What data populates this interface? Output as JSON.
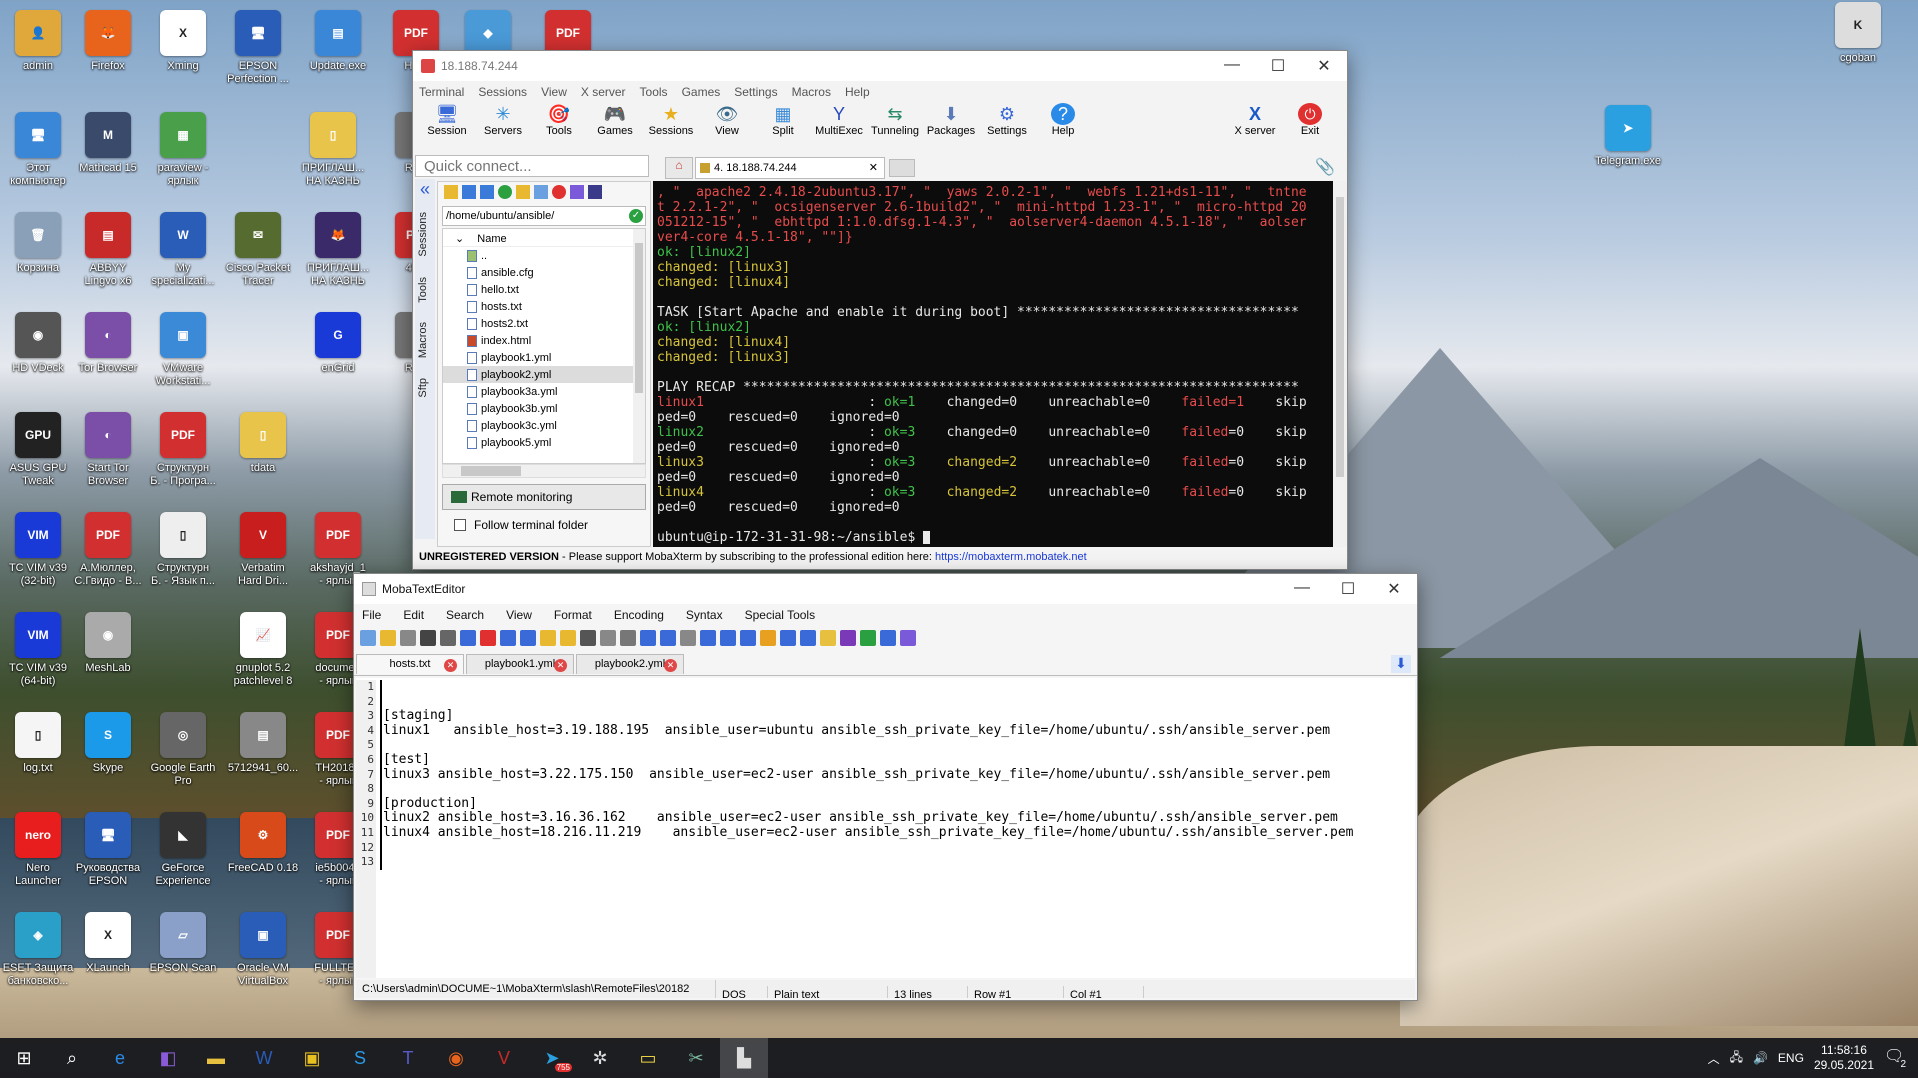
{
  "desktop_icons": [
    {
      "name": "admin",
      "label": "admin",
      "color": "#e0a83a",
      "glyph": "👤"
    },
    {
      "name": "firefox",
      "label": "Firefox",
      "color": "#e8641c",
      "glyph": "🦊"
    },
    {
      "name": "xming",
      "label": "Xming",
      "color": "#ffffff",
      "glyph": "X"
    },
    {
      "name": "epson-perfection",
      "label": "EPSON\nPerfection ...",
      "color": "#2a5db8",
      "glyph": "🖥"
    },
    {
      "name": "update-exe",
      "label": "Update.exe",
      "color": "#3a87d8",
      "glyph": "▤"
    },
    {
      "name": "pdf-hem",
      "label": "Hem",
      "color": "#d23030",
      "glyph": "PDF"
    },
    {
      "name": "app-colorful",
      "label": "",
      "color": "#4a9ad8",
      "glyph": "◆"
    },
    {
      "name": "pdf-top",
      "label": "",
      "color": "#d23030",
      "glyph": "PDF"
    },
    {
      "name": "this-computer",
      "label": "Этот\nкомпьютер",
      "color": "#3a87d8",
      "glyph": "🖥"
    },
    {
      "name": "mathcad",
      "label": "Mathcad 15",
      "color": "#3a4a6a",
      "glyph": "M"
    },
    {
      "name": "paraview",
      "label": "paraview -\nярлык",
      "color": "#4aa04a",
      "glyph": "▦"
    },
    {
      "name": "folder-priglash1",
      "label": "ПРИГЛАШ...\nНА КАЗНЬ",
      "color": "#e8c44a",
      "glyph": "▯"
    },
    {
      "name": "repo1",
      "label": "Repo",
      "color": "#777",
      "glyph": "▮"
    },
    {
      "name": "recycle-bin",
      "label": "Корзина",
      "color": "#8aa0b8",
      "glyph": "🗑"
    },
    {
      "name": "abbyy-lingvo",
      "label": "ABBYY\nLingvo x6",
      "color": "#c82a2a",
      "glyph": "▤"
    },
    {
      "name": "my-specialization",
      "label": "My\nspecializati...",
      "color": "#2a5db8",
      "glyph": "W"
    },
    {
      "name": "cisco-packet-tracer",
      "label": "Cisco Packet\nTracer",
      "color": "#556b2f",
      "glyph": "✉"
    },
    {
      "name": "priglash-firefox",
      "label": "ПРИГЛАШ...\nНА КАЗНЬ",
      "color": "#3a2a6a",
      "glyph": "🦊"
    },
    {
      "name": "pdf-4510",
      "label": "4510",
      "color": "#d23030",
      "glyph": "PDF"
    },
    {
      "name": "hd-vdeck",
      "label": "HD VDeck",
      "color": "#555",
      "glyph": "◉"
    },
    {
      "name": "tor-browser",
      "label": "Tor Browser",
      "color": "#7b4fa8",
      "glyph": "◐"
    },
    {
      "name": "vmware",
      "label": "VMware\nWorkstati...",
      "color": "#3a8ad8",
      "glyph": "▣"
    },
    {
      "name": "engrid",
      "label": "enGrid",
      "color": "#1a3ad8",
      "glyph": "G"
    },
    {
      "name": "repo2",
      "label": "Repo",
      "color": "#777",
      "glyph": "▮"
    },
    {
      "name": "asus-gpu-tweak",
      "label": "ASUS GPU\nTweak",
      "color": "#222",
      "glyph": "GPU"
    },
    {
      "name": "start-tor-browser",
      "label": "Start Tor\nBrowser",
      "color": "#7b4fa8",
      "glyph": "◐"
    },
    {
      "name": "pdf-struktur1",
      "label": "Структурн\nБ. - Програ...",
      "color": "#d23030",
      "glyph": "PDF"
    },
    {
      "name": "tdata",
      "label": "tdata",
      "color": "#e8c44a",
      "glyph": "▯"
    },
    {
      "name": "tc-vim-32",
      "label": "TC VIM v39\n(32-bit)",
      "color": "#1a3ad8",
      "glyph": "VIM"
    },
    {
      "name": "pdf-muller",
      "label": "А.Мюллер,\nС.Гвидо - В...",
      "color": "#d23030",
      "glyph": "PDF"
    },
    {
      "name": "file-struktur2",
      "label": "Структурн\nБ. - Язык п...",
      "color": "#eee",
      "glyph": "▯"
    },
    {
      "name": "verbatim",
      "label": "Verbatim\nHard Dri...",
      "color": "#c81e1e",
      "glyph": "V"
    },
    {
      "name": "pdf-akshayjd",
      "label": "akshayjd_1\n- ярлык",
      "color": "#d23030",
      "glyph": "PDF"
    },
    {
      "name": "tc-vim-64",
      "label": "TC VIM v39\n(64-bit)",
      "color": "#1a3ad8",
      "glyph": "VIM"
    },
    {
      "name": "meshlab",
      "label": "MeshLab",
      "color": "#aaa",
      "glyph": "◉"
    },
    {
      "name": "gnuplot",
      "label": "gnuplot 5.2\npatchlevel 8",
      "color": "#fff",
      "glyph": "📈"
    },
    {
      "name": "pdf-document",
      "label": "documen\n- ярлык",
      "color": "#d23030",
      "glyph": "PDF"
    },
    {
      "name": "log-txt",
      "label": "log.txt",
      "color": "#f5f5f5",
      "glyph": "▯"
    },
    {
      "name": "skype",
      "label": "Skype",
      "color": "#1a9ae8",
      "glyph": "S"
    },
    {
      "name": "google-earth-pro",
      "label": "Google Earth\nPro",
      "color": "#666",
      "glyph": "◎"
    },
    {
      "name": "file-5712941",
      "label": "5712941_60...",
      "color": "#888",
      "glyph": "▤"
    },
    {
      "name": "pdf-th2018",
      "label": "TH20180\n- ярлык",
      "color": "#d23030",
      "glyph": "PDF"
    },
    {
      "name": "nero-launcher",
      "label": "Nero\nLauncher",
      "color": "#e81e1e",
      "glyph": "nero"
    },
    {
      "name": "epson-guide",
      "label": "Руководства\nEPSON",
      "color": "#2a5db8",
      "glyph": "🖥"
    },
    {
      "name": "geforce-experience",
      "label": "GeForce\nExperience",
      "color": "#333",
      "glyph": "◣"
    },
    {
      "name": "freecad",
      "label": "FreeCAD 0.18",
      "color": "#d84a1a",
      "glyph": "⚙"
    },
    {
      "name": "pdf-ie5b",
      "label": "ie5b0048\n- ярлык",
      "color": "#d23030",
      "glyph": "PDF"
    },
    {
      "name": "eset",
      "label": "ESET Защита\nбанковско...",
      "color": "#2aa0c8",
      "glyph": "◈"
    },
    {
      "name": "xlaunch",
      "label": "XLaunch",
      "color": "#fff",
      "glyph": "X"
    },
    {
      "name": "epson-scan",
      "label": "EPSON Scan",
      "color": "#8aa0c8",
      "glyph": "▱"
    },
    {
      "name": "oracle-vm",
      "label": "Oracle VM\nVirtualBox",
      "color": "#2a5db8",
      "glyph": "▣"
    },
    {
      "name": "pdf-fulltext",
      "label": "FULLTEX\n- ярлык",
      "color": "#d23030",
      "glyph": "PDF"
    },
    {
      "name": "cgoban",
      "label": "cgoban",
      "color": "#ddd",
      "glyph": "K"
    },
    {
      "name": "telegram",
      "label": "Telegram.exe",
      "color": "#2aa0e0",
      "glyph": "➤"
    }
  ],
  "moba": {
    "title": "18.188.74.244",
    "menu": [
      "Terminal",
      "Sessions",
      "View",
      "X server",
      "Tools",
      "Games",
      "Settings",
      "Macros",
      "Help"
    ],
    "toolbar": [
      {
        "label": "Session",
        "glyph": "🖥"
      },
      {
        "label": "Servers",
        "glyph": "✳"
      },
      {
        "label": "Tools",
        "glyph": "🎯"
      },
      {
        "label": "Games",
        "glyph": "🎮"
      },
      {
        "label": "Sessions",
        "glyph": "★"
      },
      {
        "label": "View",
        "glyph": "👁"
      },
      {
        "label": "Split",
        "glyph": "▦"
      },
      {
        "label": "MultiExec",
        "glyph": "Y"
      },
      {
        "label": "Tunneling",
        "glyph": "⇆"
      },
      {
        "label": "Packages",
        "glyph": "⬇"
      },
      {
        "label": "Settings",
        "glyph": "⚙"
      },
      {
        "label": "Help",
        "glyph": "?"
      }
    ],
    "xserver_label": "X server",
    "exit_label": "Exit",
    "quick_connect_placeholder": "Quick connect...",
    "session_tab": "4. 18.188.74.244",
    "side_tabs": [
      "Sessions",
      "Tools",
      "Macros",
      "Sftp"
    ],
    "sftp_path": "/home/ubuntu/ansible/",
    "sftp_header": "Name",
    "sftp_files": [
      "..",
      "ansible.cfg",
      "hello.txt",
      "hosts.txt",
      "hosts2.txt",
      "index.html",
      "playbook1.yml",
      "playbook2.yml",
      "playbook3a.yml",
      "playbook3b.yml",
      "playbook3c.yml",
      "playbook5.yml"
    ],
    "remote_monitoring": "Remote monitoring",
    "follow_folder": "Follow terminal folder",
    "unregistered": "UNREGISTERED VERSION",
    "support_text": " -  Please support MobaXterm by subscribing to the professional edition here: ",
    "support_link": "https://mobaxterm.mobatek.net",
    "terminal_lines": [
      [
        {
          "c": "t-red",
          "t": ", \"  apache2 2.4.18-2ubuntu3.17\", \"  yaws 2.0.2-1\", \"  webfs 1.21+ds1-11\", \"  tntne"
        }
      ],
      [
        {
          "c": "t-red",
          "t": "t 2.2.1-2\", \"  ocsigenserver 2.6-1build2\", \"  mini-httpd 1.23-1\", \"  micro-httpd 20"
        }
      ],
      [
        {
          "c": "t-red",
          "t": "051212-15\", \"  ebhttpd 1:1.0.dfsg.1-4.3\", \"  aolserver4-daemon 4.5.1-18\", \"  aolser"
        }
      ],
      [
        {
          "c": "t-red",
          "t": "ver4-core 4.5.1-18\", \"\"]}"
        }
      ],
      [
        {
          "c": "t-grn",
          "t": "ok: [linux2]"
        }
      ],
      [
        {
          "c": "t-yel",
          "t": "changed: [linux3]"
        }
      ],
      [
        {
          "c": "t-yel",
          "t": "changed: [linux4]"
        }
      ],
      [
        {
          "c": "",
          "t": ""
        }
      ],
      [
        {
          "c": "t-wht",
          "t": "TASK [Start Apache and enable it during boot] ************************************"
        }
      ],
      [
        {
          "c": "t-grn",
          "t": "ok: [linux2]"
        }
      ],
      [
        {
          "c": "t-yel",
          "t": "changed: [linux4]"
        }
      ],
      [
        {
          "c": "t-yel",
          "t": "changed: [linux3]"
        }
      ],
      [
        {
          "c": "",
          "t": ""
        }
      ],
      [
        {
          "c": "t-wht",
          "t": "PLAY RECAP ***********************************************************************"
        }
      ],
      [
        {
          "c": "t-red",
          "t": "linux1"
        },
        {
          "c": "t-wht",
          "t": "                     : "
        },
        {
          "c": "t-grn",
          "t": "ok=1"
        },
        {
          "c": "t-wht",
          "t": "    changed=0    unreachable=0    "
        },
        {
          "c": "t-red",
          "t": "failed=1"
        },
        {
          "c": "t-wht",
          "t": "    skip"
        }
      ],
      [
        {
          "c": "t-wht",
          "t": "ped=0    rescued=0    ignored=0"
        }
      ],
      [
        {
          "c": "t-grn",
          "t": "linux2"
        },
        {
          "c": "t-wht",
          "t": "                     : "
        },
        {
          "c": "t-grn",
          "t": "ok=3"
        },
        {
          "c": "t-wht",
          "t": "    changed=0    unreachable=0    "
        },
        {
          "c": "t-red",
          "t": "failed"
        },
        {
          "c": "t-wht",
          "t": "=0    skip"
        }
      ],
      [
        {
          "c": "t-wht",
          "t": "ped=0    rescued=0    ignored=0"
        }
      ],
      [
        {
          "c": "t-yel",
          "t": "linux3"
        },
        {
          "c": "t-wht",
          "t": "                     : "
        },
        {
          "c": "t-grn",
          "t": "ok=3"
        },
        {
          "c": "t-wht",
          "t": "    "
        },
        {
          "c": "t-yel",
          "t": "changed=2"
        },
        {
          "c": "t-wht",
          "t": "    unreachable=0    "
        },
        {
          "c": "t-red",
          "t": "failed"
        },
        {
          "c": "t-wht",
          "t": "=0    skip"
        }
      ],
      [
        {
          "c": "t-wht",
          "t": "ped=0    rescued=0    ignored=0"
        }
      ],
      [
        {
          "c": "t-yel",
          "t": "linux4"
        },
        {
          "c": "t-wht",
          "t": "                     : "
        },
        {
          "c": "t-grn",
          "t": "ok=3"
        },
        {
          "c": "t-wht",
          "t": "    "
        },
        {
          "c": "t-yel",
          "t": "changed=2"
        },
        {
          "c": "t-wht",
          "t": "    unreachable=0    "
        },
        {
          "c": "t-red",
          "t": "failed"
        },
        {
          "c": "t-wht",
          "t": "=0    skip"
        }
      ],
      [
        {
          "c": "t-wht",
          "t": "ped=0    rescued=0    ignored=0"
        }
      ],
      [
        {
          "c": "",
          "t": ""
        }
      ],
      [
        {
          "c": "t-wht",
          "t": "ubuntu@ip-172-31-31-98:~/ansible$ "
        }
      ]
    ]
  },
  "editor": {
    "title": "MobaTextEditor",
    "menu": [
      "File",
      "Edit",
      "Search",
      "View",
      "Format",
      "Encoding",
      "Syntax",
      "Special Tools"
    ],
    "tabs": [
      "hosts.txt",
      "playbook1.yml",
      "playbook2.yml"
    ],
    "lines": [
      "",
      "",
      "[staging]",
      "linux1   ansible_host=3.19.188.195  ansible_user=ubuntu ansible_ssh_private_key_file=/home/ubuntu/.ssh/ansible_server.pem",
      "",
      "[test]",
      "linux3 ansible_host=3.22.175.150  ansible_user=ec2-user ansible_ssh_private_key_file=/home/ubuntu/.ssh/ansible_server.pem",
      "",
      "[production]",
      "linux2 ansible_host=3.16.36.162    ansible_user=ec2-user ansible_ssh_private_key_file=/home/ubuntu/.ssh/ansible_server.pem",
      "linux4 ansible_host=18.216.11.219    ansible_user=ec2-user ansible_ssh_private_key_file=/home/ubuntu/.ssh/ansible_server.pem",
      "",
      ""
    ],
    "status": {
      "path": "C:\\Users\\admin\\DOCUME~1\\MobaXterm\\slash\\RemoteFiles\\20182",
      "eol": "DOS",
      "syntax": "Plain text",
      "lines": "13 lines",
      "row": "Row #1",
      "col": "Col #1"
    }
  },
  "taskbar": {
    "items": [
      "windows-start",
      "search",
      "edge",
      "visual-studio",
      "file-explorer",
      "word",
      "app-yellow",
      "skype",
      "teams",
      "firefox",
      "vim",
      "telegram",
      "app-gear",
      "app-folder",
      "app-snip",
      "mobaxterm-active"
    ],
    "telegram_badge": "755",
    "lang": "ENG",
    "time": "11:58:16",
    "date": "29.05.2021",
    "notif_count": "2"
  }
}
